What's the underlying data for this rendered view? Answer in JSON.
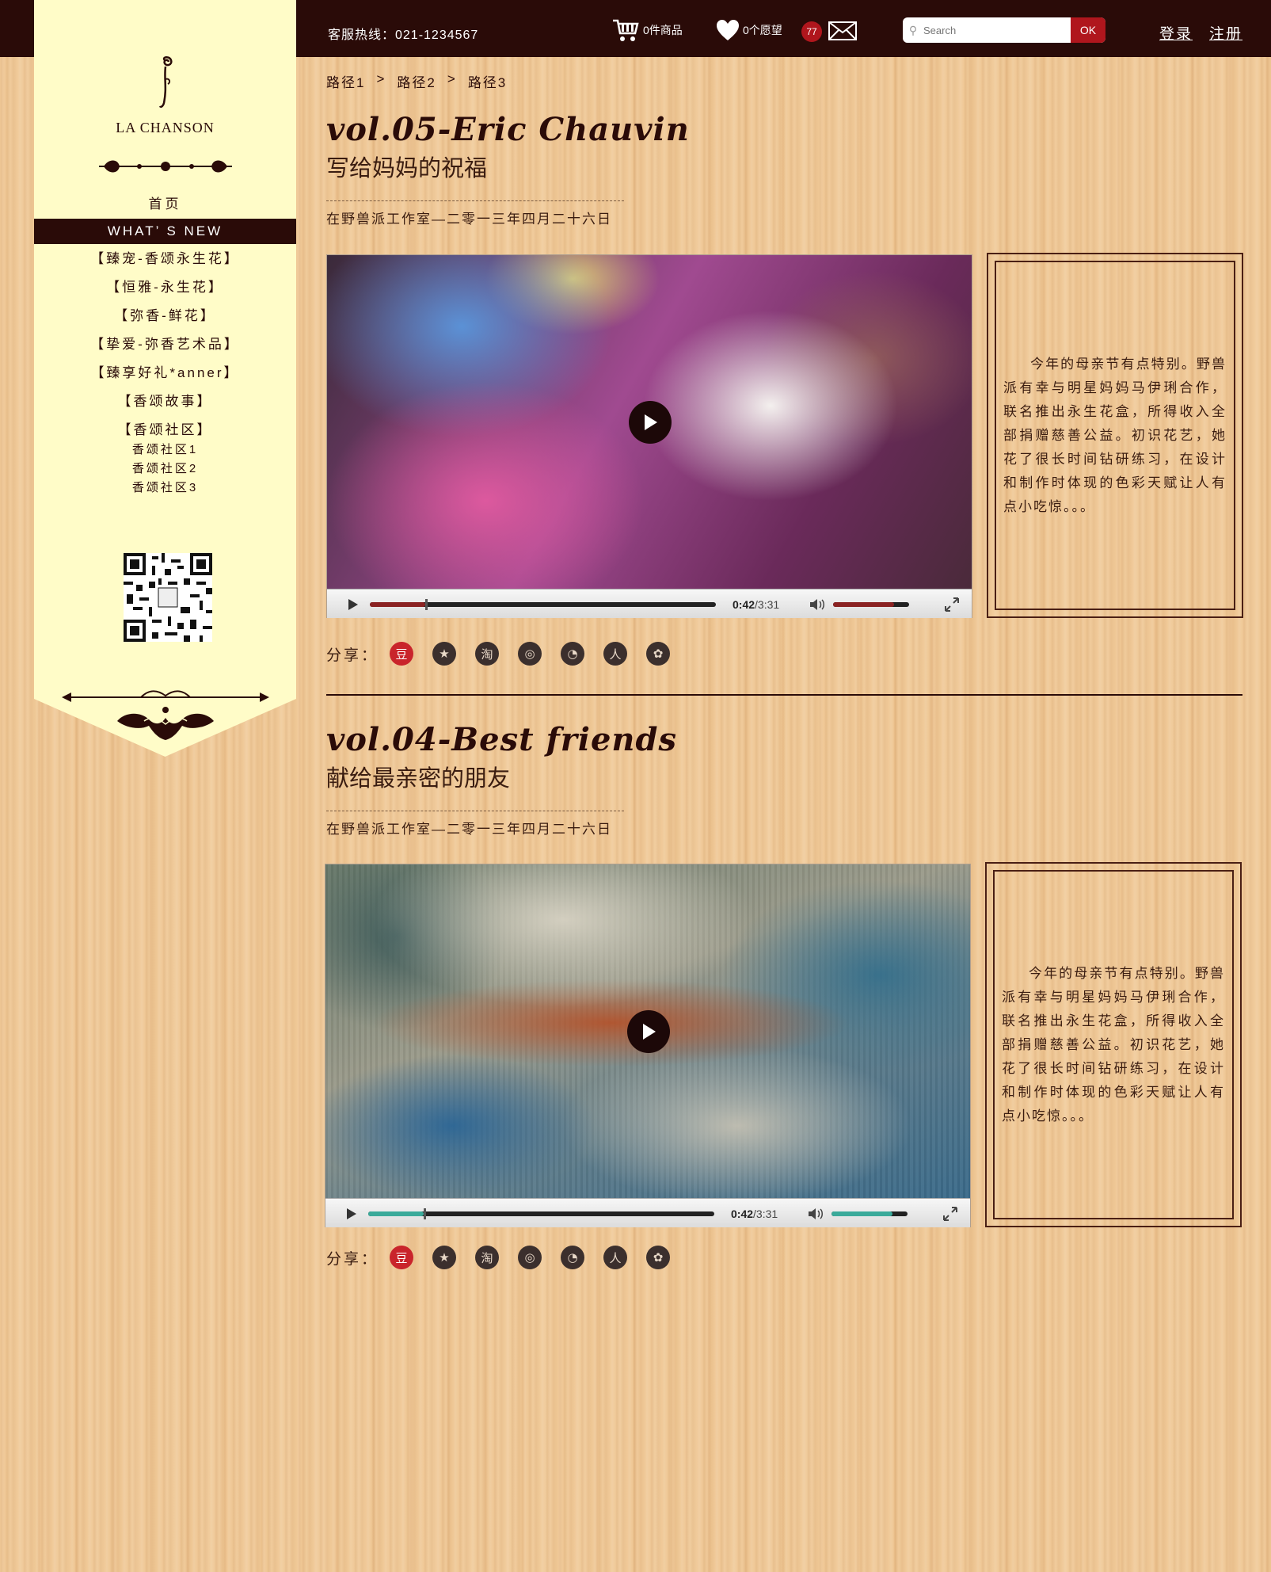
{
  "header": {
    "hotline": "客服热线：021-1234567",
    "cart_label": "0件商品",
    "wish_label": "0个愿望",
    "message_count": "77",
    "search_placeholder": "Search",
    "search_button": "OK",
    "login": "登录",
    "register": "注册"
  },
  "sidebar": {
    "brand": "LA CHANSON",
    "home": "首页",
    "active": "WHAT’ S NEW",
    "items": [
      "【臻宠-香颂永生花】",
      "【恒雅-永生花】",
      "【弥香-鲜花】",
      "【挚爱-弥香艺术品】",
      "【臻享好礼*anner】",
      "【香颂故事】",
      "【香颂社区】"
    ],
    "sub_items": [
      "香颂社区1",
      "香颂社区2",
      "香颂社区3"
    ]
  },
  "breadcrumb": [
    "路径1",
    ">",
    "路径2",
    ">",
    "路径3"
  ],
  "articles": [
    {
      "title": "vol.05-Eric Chauvin",
      "subtitle": "写给妈妈的祝福",
      "date": "在野兽派工作室—二零一三年四月二十六日",
      "time_current": "0:42",
      "time_total": "/3:31",
      "progress": 0.16,
      "volume": 0.8,
      "accent": "#8a2222",
      "description": "今年的母亲节有点特别。野兽派有幸与明星妈妈马伊琍合作，联名推出永生花盒，所得收入全部捐赠慈善公益。初识花艺，她花了很长时间钻研练习，在设计和制作时体现的色彩天赋让人有点小吃惊。。。",
      "share_label": "分享："
    },
    {
      "title": "vol.04-Best friends",
      "subtitle": "献给最亲密的朋友",
      "date": "在野兽派工作室—二零一三年四月二十六日",
      "time_current": "0:42",
      "time_total": "/3:31",
      "progress": 0.16,
      "volume": 0.8,
      "accent": "#3aaa9a",
      "description": "今年的母亲节有点特别。野兽派有幸与明星妈妈马伊琍合作，联名推出永生花盒，所得收入全部捐赠慈善公益。初识花艺，她花了很长时间钻研练习，在设计和制作时体现的色彩天赋让人有点小吃惊。。。",
      "share_label": "分享："
    }
  ],
  "share_icons": [
    {
      "name": "douban-icon",
      "glyph": "豆",
      "red": true
    },
    {
      "name": "qzone-icon",
      "glyph": "★",
      "red": false
    },
    {
      "name": "taobao-icon",
      "glyph": "淘",
      "red": false
    },
    {
      "name": "weibo-icon",
      "glyph": "◎",
      "red": false
    },
    {
      "name": "tencent-weibo-icon",
      "glyph": "◔",
      "red": false
    },
    {
      "name": "renren-icon",
      "glyph": "人",
      "red": false
    },
    {
      "name": "wechat-icon",
      "glyph": "✿",
      "red": false
    }
  ]
}
